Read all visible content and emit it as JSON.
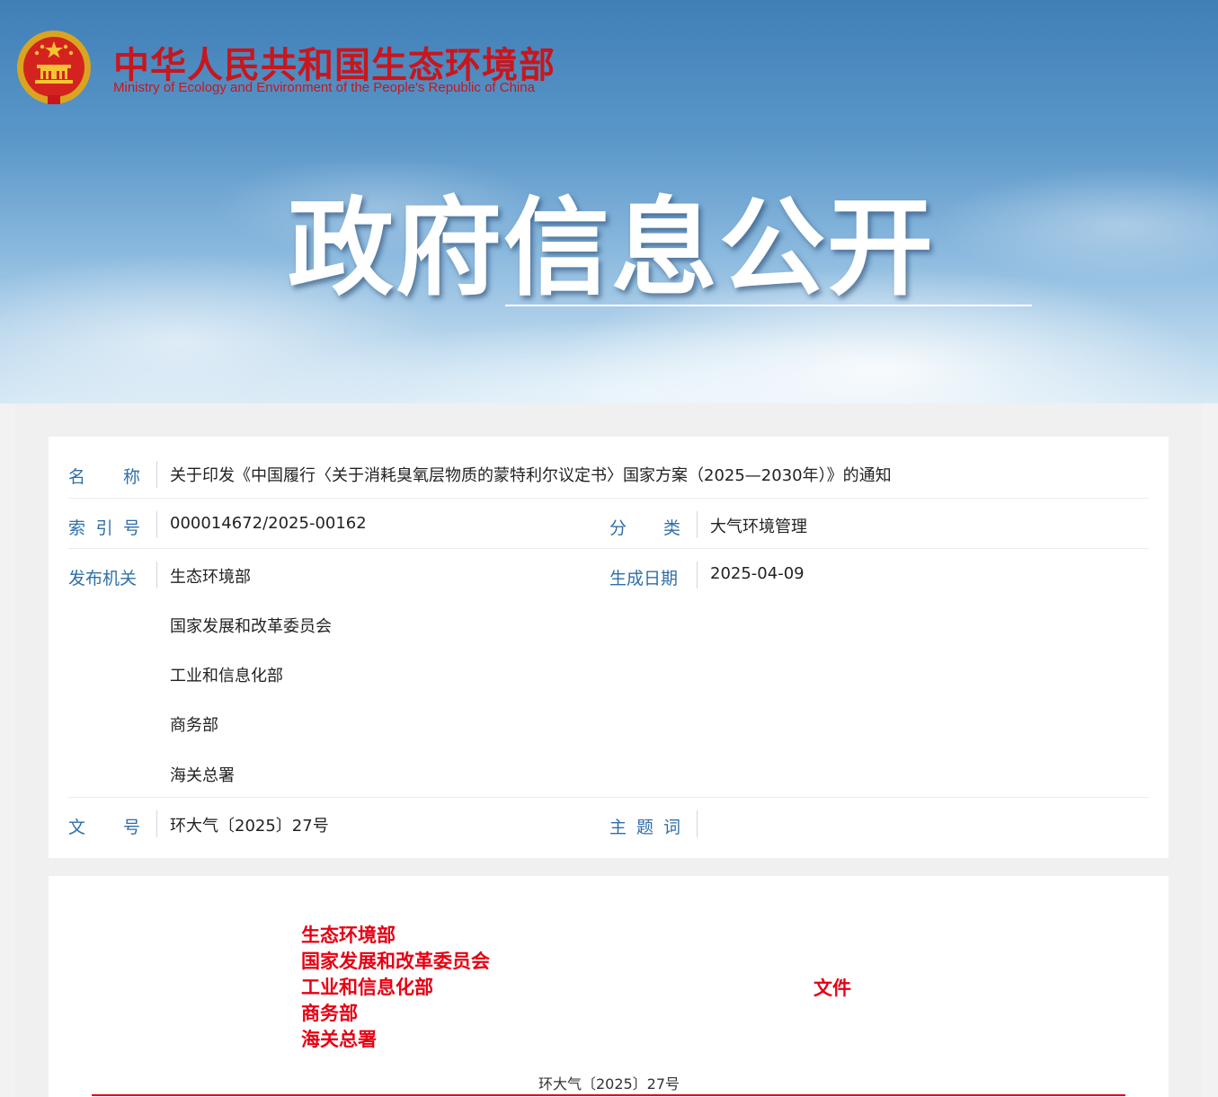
{
  "header": {
    "org_name_cn": "中华人民共和国生态环境部",
    "org_name_en": "Ministry of Ecology and Environment of the People's Republic of China",
    "page_title": "政府信息公开"
  },
  "info": {
    "name_label": [
      "名",
      "称"
    ],
    "name_value": "关于印发《中国履行〈关于消耗臭氧层物质的蒙特利尔议定书〉国家方案（2025—2030年）》的通知",
    "index_label": [
      "索",
      "引",
      "号"
    ],
    "index_value": "000014672/2025-00162",
    "category_label": [
      "分",
      "类"
    ],
    "category_value": "大气环境管理",
    "issuer_label": "发布机关",
    "issuers": [
      "生态环境部",
      "国家发展和改革委员会",
      "工业和信息化部",
      "商务部",
      "海关总署"
    ],
    "date_label": "生成日期",
    "date_value": "2025-04-09",
    "docno_label": [
      "文",
      "号"
    ],
    "docno_value": "环大气〔2025〕27号",
    "keywords_label": [
      "主",
      "题",
      "词"
    ],
    "keywords_value": ""
  },
  "document": {
    "issuers": [
      "生态环境部",
      "国家发展和改革委员会",
      "工业和信息化部",
      "商务部",
      "海关总署"
    ],
    "file_word": "文件",
    "doc_number": "环大气〔2025〕27号"
  },
  "colors": {
    "brand_red": "#c8161d",
    "label_blue": "#2f6fa8",
    "doc_red": "#e60012"
  }
}
